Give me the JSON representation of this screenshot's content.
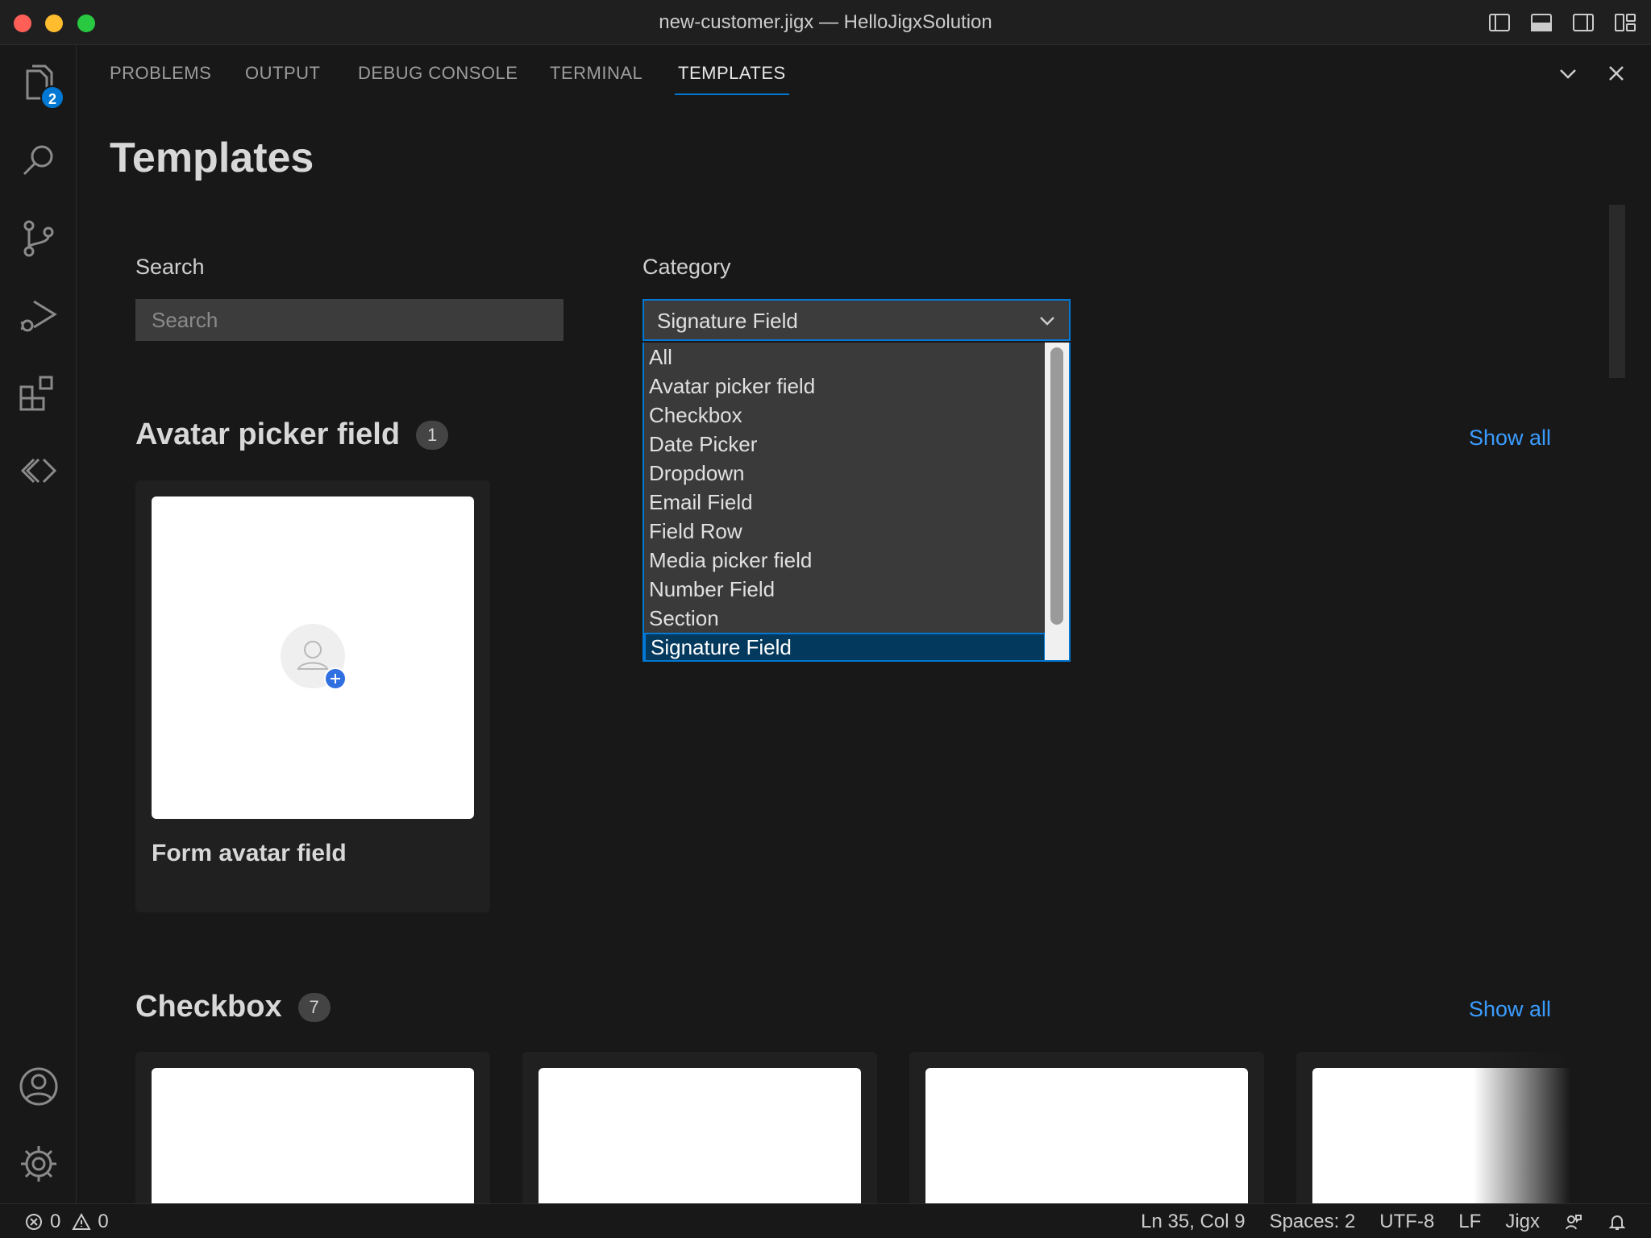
{
  "window": {
    "title": "new-customer.jigx — HelloJigxSolution"
  },
  "activity_bar": {
    "explorer_badge": "2"
  },
  "panel_tabs": [
    {
      "label": "PROBLEMS"
    },
    {
      "label": "OUTPUT"
    },
    {
      "label": "DEBUG CONSOLE"
    },
    {
      "label": "TERMINAL"
    },
    {
      "label": "TEMPLATES",
      "active": true
    }
  ],
  "page": {
    "title": "Templates",
    "search_label": "Search",
    "search_placeholder": "Search",
    "category_label": "Category",
    "category_selected": "Signature Field",
    "category_options": [
      "All",
      "Avatar picker field",
      "Checkbox",
      "Date Picker",
      "Dropdown",
      "Email Field",
      "Field Row",
      "Media picker field",
      "Number Field",
      "Section",
      "Signature Field"
    ]
  },
  "sections": [
    {
      "title": "Avatar picker field",
      "count": "1",
      "show_all": "Show all",
      "cards": [
        {
          "label": "Form avatar field"
        }
      ]
    },
    {
      "title": "Checkbox",
      "count": "7",
      "show_all": "Show all"
    }
  ],
  "status_bar": {
    "errors": "0",
    "warnings": "0",
    "position": "Ln 35, Col 9",
    "spaces": "Spaces: 2",
    "encoding": "UTF-8",
    "eol": "LF",
    "language": "Jigx"
  },
  "colors": {
    "accent": "#0078d4",
    "link": "#3b9cff",
    "background": "#181818"
  }
}
